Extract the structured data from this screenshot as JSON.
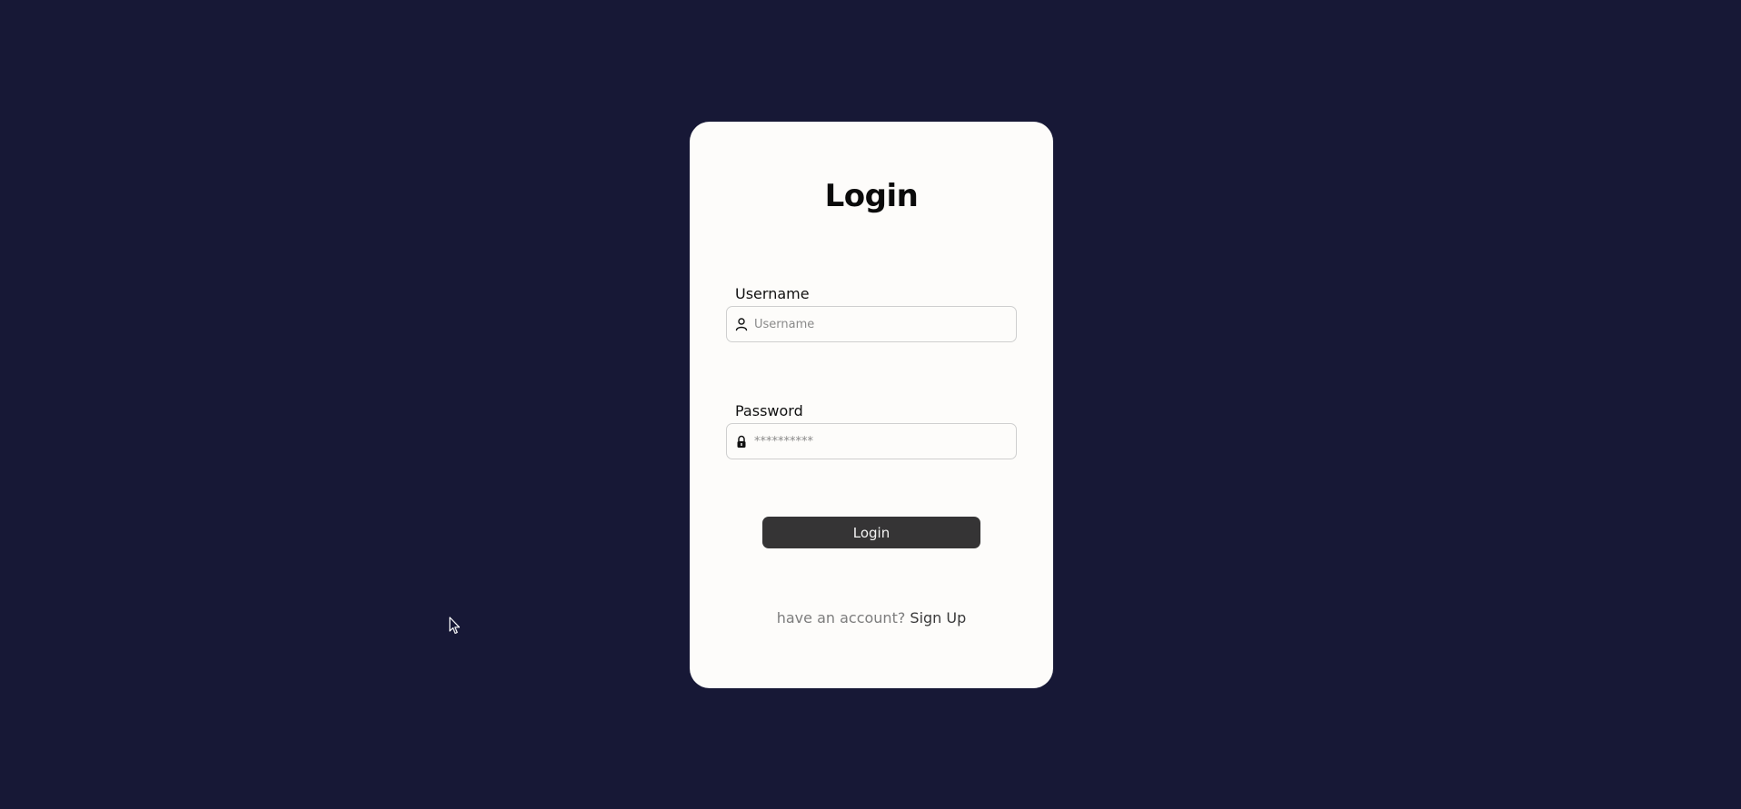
{
  "page": {
    "background_color": "#171836",
    "card_color": "#fdfcfa",
    "button_color": "#353435"
  },
  "login_card": {
    "title": "Login",
    "username": {
      "label": "Username",
      "placeholder": "Username",
      "value": "",
      "icon": "user-icon"
    },
    "password": {
      "label": "Password",
      "placeholder": "**********",
      "value": "",
      "icon": "lock-icon"
    },
    "submit_label": "Login",
    "signup_prompt": "have an account?",
    "signup_link": "Sign Up"
  },
  "cursor": {
    "icon": "mouse-pointer-icon"
  }
}
